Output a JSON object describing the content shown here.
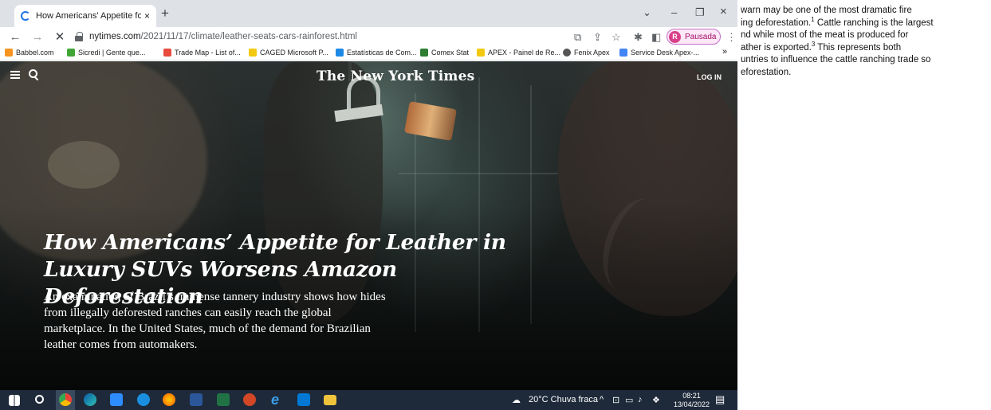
{
  "browser": {
    "tab": {
      "title": "How Americans' Appetite for Lea",
      "close": "×"
    },
    "new_tab": "+",
    "window_controls": {
      "dropdown": "⌄",
      "minimize": "–",
      "restore": "❐",
      "close": "×"
    },
    "nav": {
      "back": "←",
      "forward": "→",
      "stop": "✕"
    },
    "url": {
      "domain": "nytimes.com",
      "path": "/2021/11/17/climate/leather-seats-cars-rainforest.html"
    },
    "profile": {
      "initial": "R",
      "label": "Pausada"
    },
    "bookmarks": [
      {
        "label": "Babbel.com",
        "color": "#f7941d"
      },
      {
        "label": "Sicredi | Gente que...",
        "color": "#3fa535"
      },
      {
        "label": "Trade Map - List of...",
        "color": "#e84a3c"
      },
      {
        "label": "CAGED Microsoft P...",
        "color": "#f2c811"
      },
      {
        "label": "Estatísticas de Com...",
        "color": "#1e88e5"
      },
      {
        "label": "Comex Stat",
        "color": "#2e7d32"
      },
      {
        "label": "APEX - Painel de Re...",
        "color": "#f2c811"
      },
      {
        "label": "Fenix Apex",
        "color": "#555555"
      },
      {
        "label": "Service Desk Apex-...",
        "color": "#4285f4"
      }
    ],
    "bookmarks_more": "»"
  },
  "article": {
    "logo": "The New York Times",
    "login": "LOG IN",
    "headline_line1": "How Americans’ Appetite for Leather in",
    "headline_line2": "Luxury SUVs Worsens Amazon Deforestation",
    "summary": "An examination of Brazil’s immense tannery industry shows how hides from illegally deforested ranches can easily reach the global marketplace. In the United States, much of the demand for Brazilian leather comes from automakers."
  },
  "taskbar": {
    "weather": "20°C  Chuva fraca",
    "time": "08:21",
    "date": "13/04/2022"
  },
  "document_fragment": {
    "line1": "warn may be one of the most dramatic fire",
    "line2a": "ing deforestation.",
    "line2_sup": "1",
    "line2b": " Cattle ranching is the largest",
    "line3": "nd while most of the meat is produced for",
    "line4a": "ather is exported.",
    "line4_sup": "3",
    "line4b": " This represents both",
    "line5": "untries to influence the cattle ranching trade so",
    "line6": "eforestation."
  }
}
